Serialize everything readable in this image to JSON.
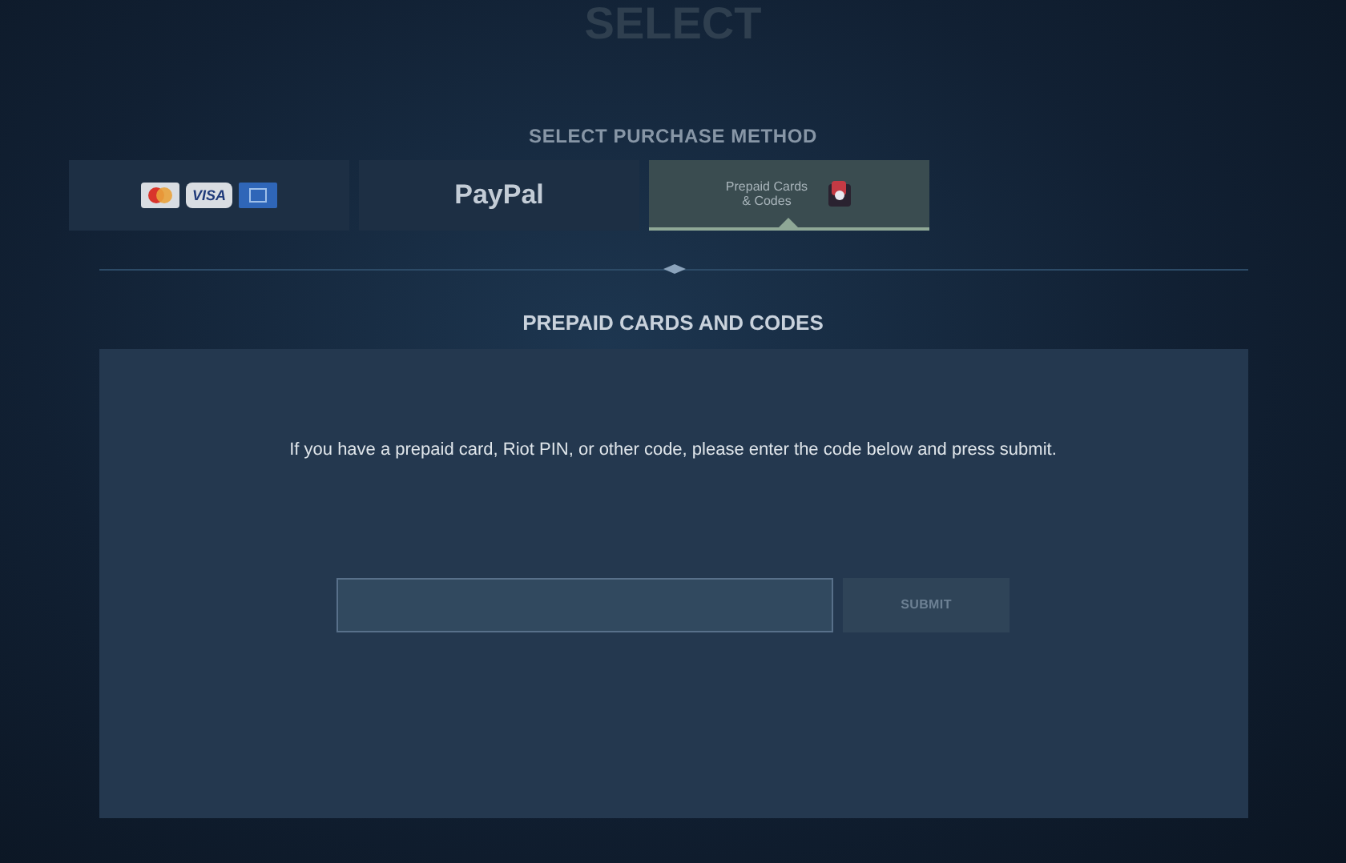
{
  "page_title": "SELECT",
  "method_label": "SELECT PURCHASE METHOD",
  "tabs": [
    {
      "kind": "cards",
      "visa": "VISA",
      "selected": false
    },
    {
      "kind": "text",
      "label": "PayPal",
      "selected": false
    },
    {
      "kind": "prepaid",
      "label": "Prepaid Cards\n& Codes",
      "selected": true
    }
  ],
  "section_title": "PREPAID CARDS AND CODES",
  "instructions": "If you have a prepaid card, Riot PIN, or other code, please enter the code below and press submit.",
  "submit_button": {
    "label": "SUBMIT",
    "disabled": true
  }
}
